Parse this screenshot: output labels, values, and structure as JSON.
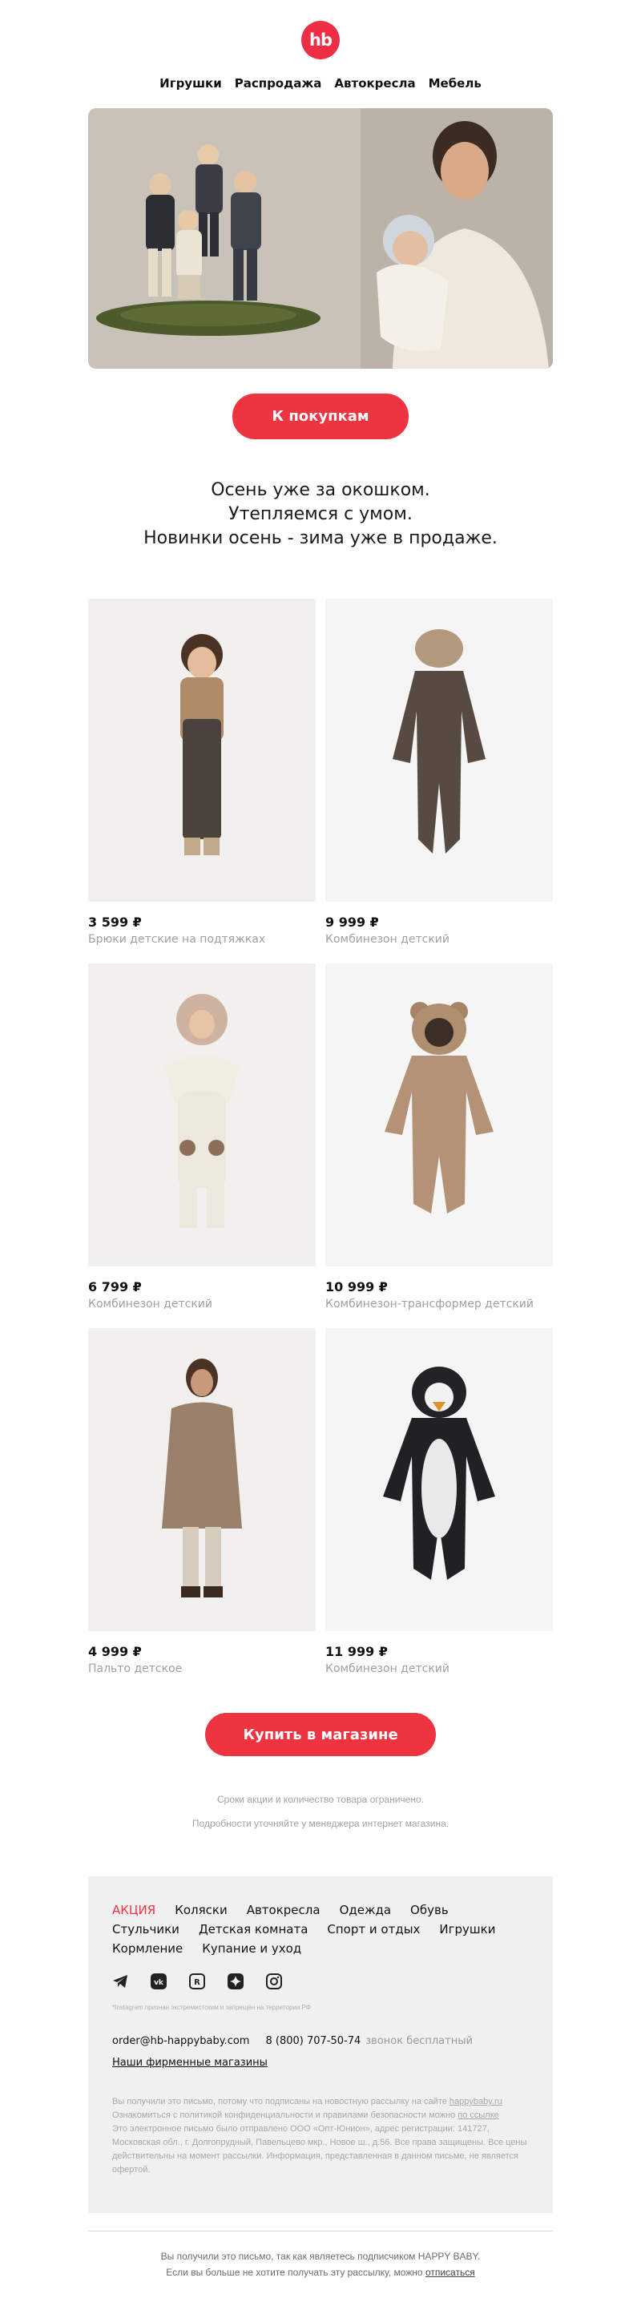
{
  "brand": {
    "logo_text": "hb",
    "accent_color": "#ee3440"
  },
  "nav": {
    "items": [
      "Игрушки",
      "Распродажа",
      "Автокресла",
      "Мебель"
    ]
  },
  "hero": {
    "cta_label": "К покупкам"
  },
  "headline": {
    "line1": "Осень уже за окошком.",
    "line2": "Утепляемся с умом.",
    "line3": "Новинки осень - зима уже в продаже."
  },
  "products": [
    {
      "price": "3 599 ₽",
      "name": "Брюки детские на подтяжках"
    },
    {
      "price": "9 999 ₽",
      "name": "Комбинезон детский"
    },
    {
      "price": "6 799 ₽",
      "name": "Комбинезон детский"
    },
    {
      "price": "10 999 ₽",
      "name": "Комбинезон-трансформер детский"
    },
    {
      "price": "4 999 ₽",
      "name": "Пальто детское"
    },
    {
      "price": "11 999 ₽",
      "name": "Комбинезон детский"
    }
  ],
  "store_cta_label": "Купить в магазине",
  "disclaimer": {
    "line1": "Сроки акции и количество товара ограничено.",
    "line2": "Подробности уточняйте у менеджера интернет магазина."
  },
  "footer": {
    "categories": [
      "АКЦИЯ",
      "Коляски",
      "Автокресла",
      "Одежда",
      "Обувь",
      "Стульчики",
      "Детская комната",
      "Спорт и отдых",
      "Игрушки",
      "Кормление",
      "Купание и уход"
    ],
    "socials": [
      "telegram-icon",
      "vk-icon",
      "rutube-icon",
      "dzen-icon",
      "instagram-icon"
    ],
    "instagram_note": "*Instagram признан экстремистским и запрещён на территории РФ",
    "email": "order@hb-happybaby.com",
    "phone": "8 (800) 707-50-74",
    "phone_note": "звонок бесплатный",
    "stores_link": "Наши фирменные магазины",
    "legal": {
      "p1_text": "Вы получили это письмо, потому что подписаны на новостную рассылку на сайте",
      "p1_link": "happybaby.ru",
      "p2_text": "Ознакомиться с политикой конфиденциальности и правилами безопасности можно",
      "p2_link": "по ссылке",
      "p3": "Это электронное письмо было отправлено ООО «Опт-Юнион», адрес регистрации: 141727, Московская обл., г. Долгопрудный, Павельцево мкр., Новое ш., д.56. Все права защищены. Все цены действительны на момент рассылки. Информация, представленная в данном письме, не является офертой."
    }
  },
  "bottom": {
    "line1": "Вы получили это письмо, так как являетесь подписчиком HAPPY BABY.",
    "line2_text": "Если вы больше не хотите получать эту рассылку, можно",
    "line2_link": "отписаться"
  }
}
